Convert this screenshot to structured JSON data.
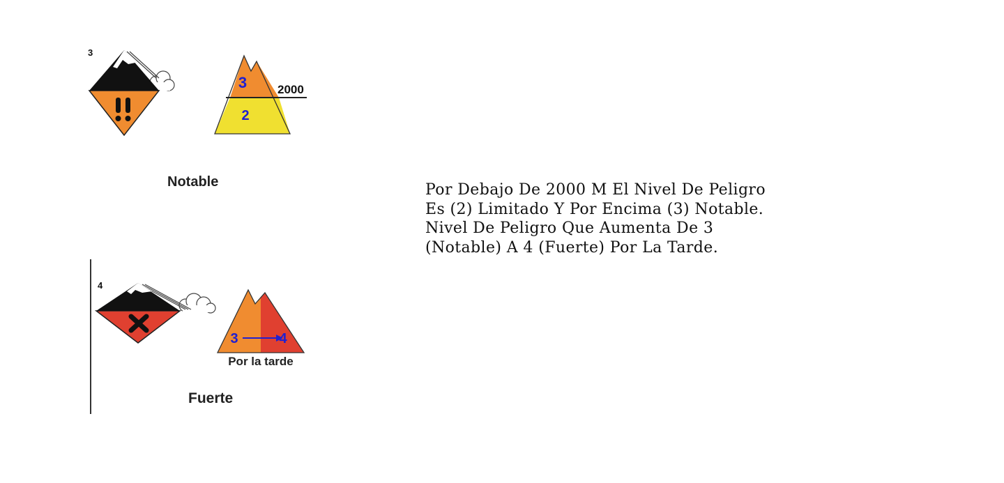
{
  "notable": {
    "level_number": "3",
    "caption": "Notable",
    "upper_level": "3",
    "lower_level": "2",
    "altitude_label": "2000",
    "colors": {
      "upper": "#f08c30",
      "lower": "#f0e030",
      "icon_bottom": "#f08c30"
    }
  },
  "fuerte": {
    "level_number": "4",
    "caption": "Fuerte",
    "from_level": "3",
    "to_level": "4",
    "timing_label": "Por la tarde",
    "colors": {
      "left": "#f08c30",
      "right": "#e04030",
      "icon_bottom": "#e04030"
    }
  },
  "description": {
    "lines": [
      "Por Debajo De 2000 M El Nivel De Peligro",
      "Es (2) Limitado Y Por Encima (3) Notable.",
      "Nivel De Peligro Que Aumenta De 3",
      "(Notable) A 4 (Fuerte) Por La Tarde."
    ]
  }
}
